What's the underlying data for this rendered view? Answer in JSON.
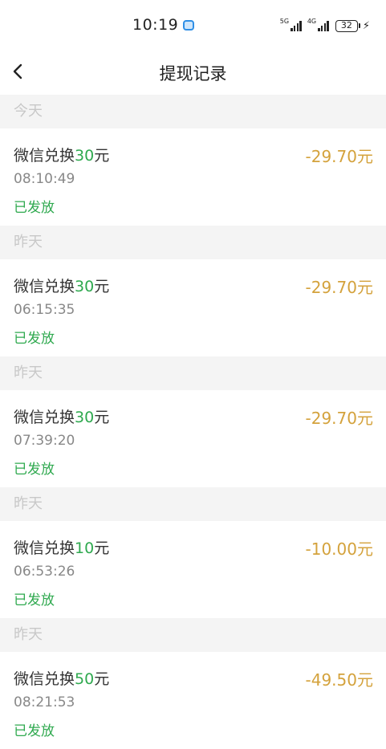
{
  "status_bar": {
    "time": "10:19",
    "network1": "5G",
    "network2": "4G",
    "battery": "32",
    "icons": [
      "app-notification-icon",
      "signal-icon",
      "battery-icon",
      "charging-bolt-icon"
    ]
  },
  "header": {
    "back_icon": "chevron-left-icon",
    "title": "提现记录"
  },
  "records": [
    {
      "date_label": "今天",
      "title_prefix": "微信兑换",
      "title_number": "30",
      "title_suffix": "元",
      "time": "08:10:49",
      "status": "已发放",
      "amount": "-29.70元"
    },
    {
      "date_label": "昨天",
      "title_prefix": "微信兑换",
      "title_number": "30",
      "title_suffix": "元",
      "time": "06:15:35",
      "status": "已发放",
      "amount": "-29.70元"
    },
    {
      "date_label": "昨天",
      "title_prefix": "微信兑换",
      "title_number": "30",
      "title_suffix": "元",
      "time": "07:39:20",
      "status": "已发放",
      "amount": "-29.70元"
    },
    {
      "date_label": "昨天",
      "title_prefix": "微信兑换",
      "title_number": "10",
      "title_suffix": "元",
      "time": "06:53:26",
      "status": "已发放",
      "amount": "-10.00元"
    },
    {
      "date_label": "昨天",
      "title_prefix": "微信兑换",
      "title_number": "50",
      "title_suffix": "元",
      "time": "08:21:53",
      "status": "已发放",
      "amount": "-49.50元"
    }
  ],
  "colors": {
    "accent_green": "#2fa94f",
    "amount_gold": "#d4a23c",
    "section_bg": "#f4f4f4",
    "date_text": "#c8c8c8"
  }
}
